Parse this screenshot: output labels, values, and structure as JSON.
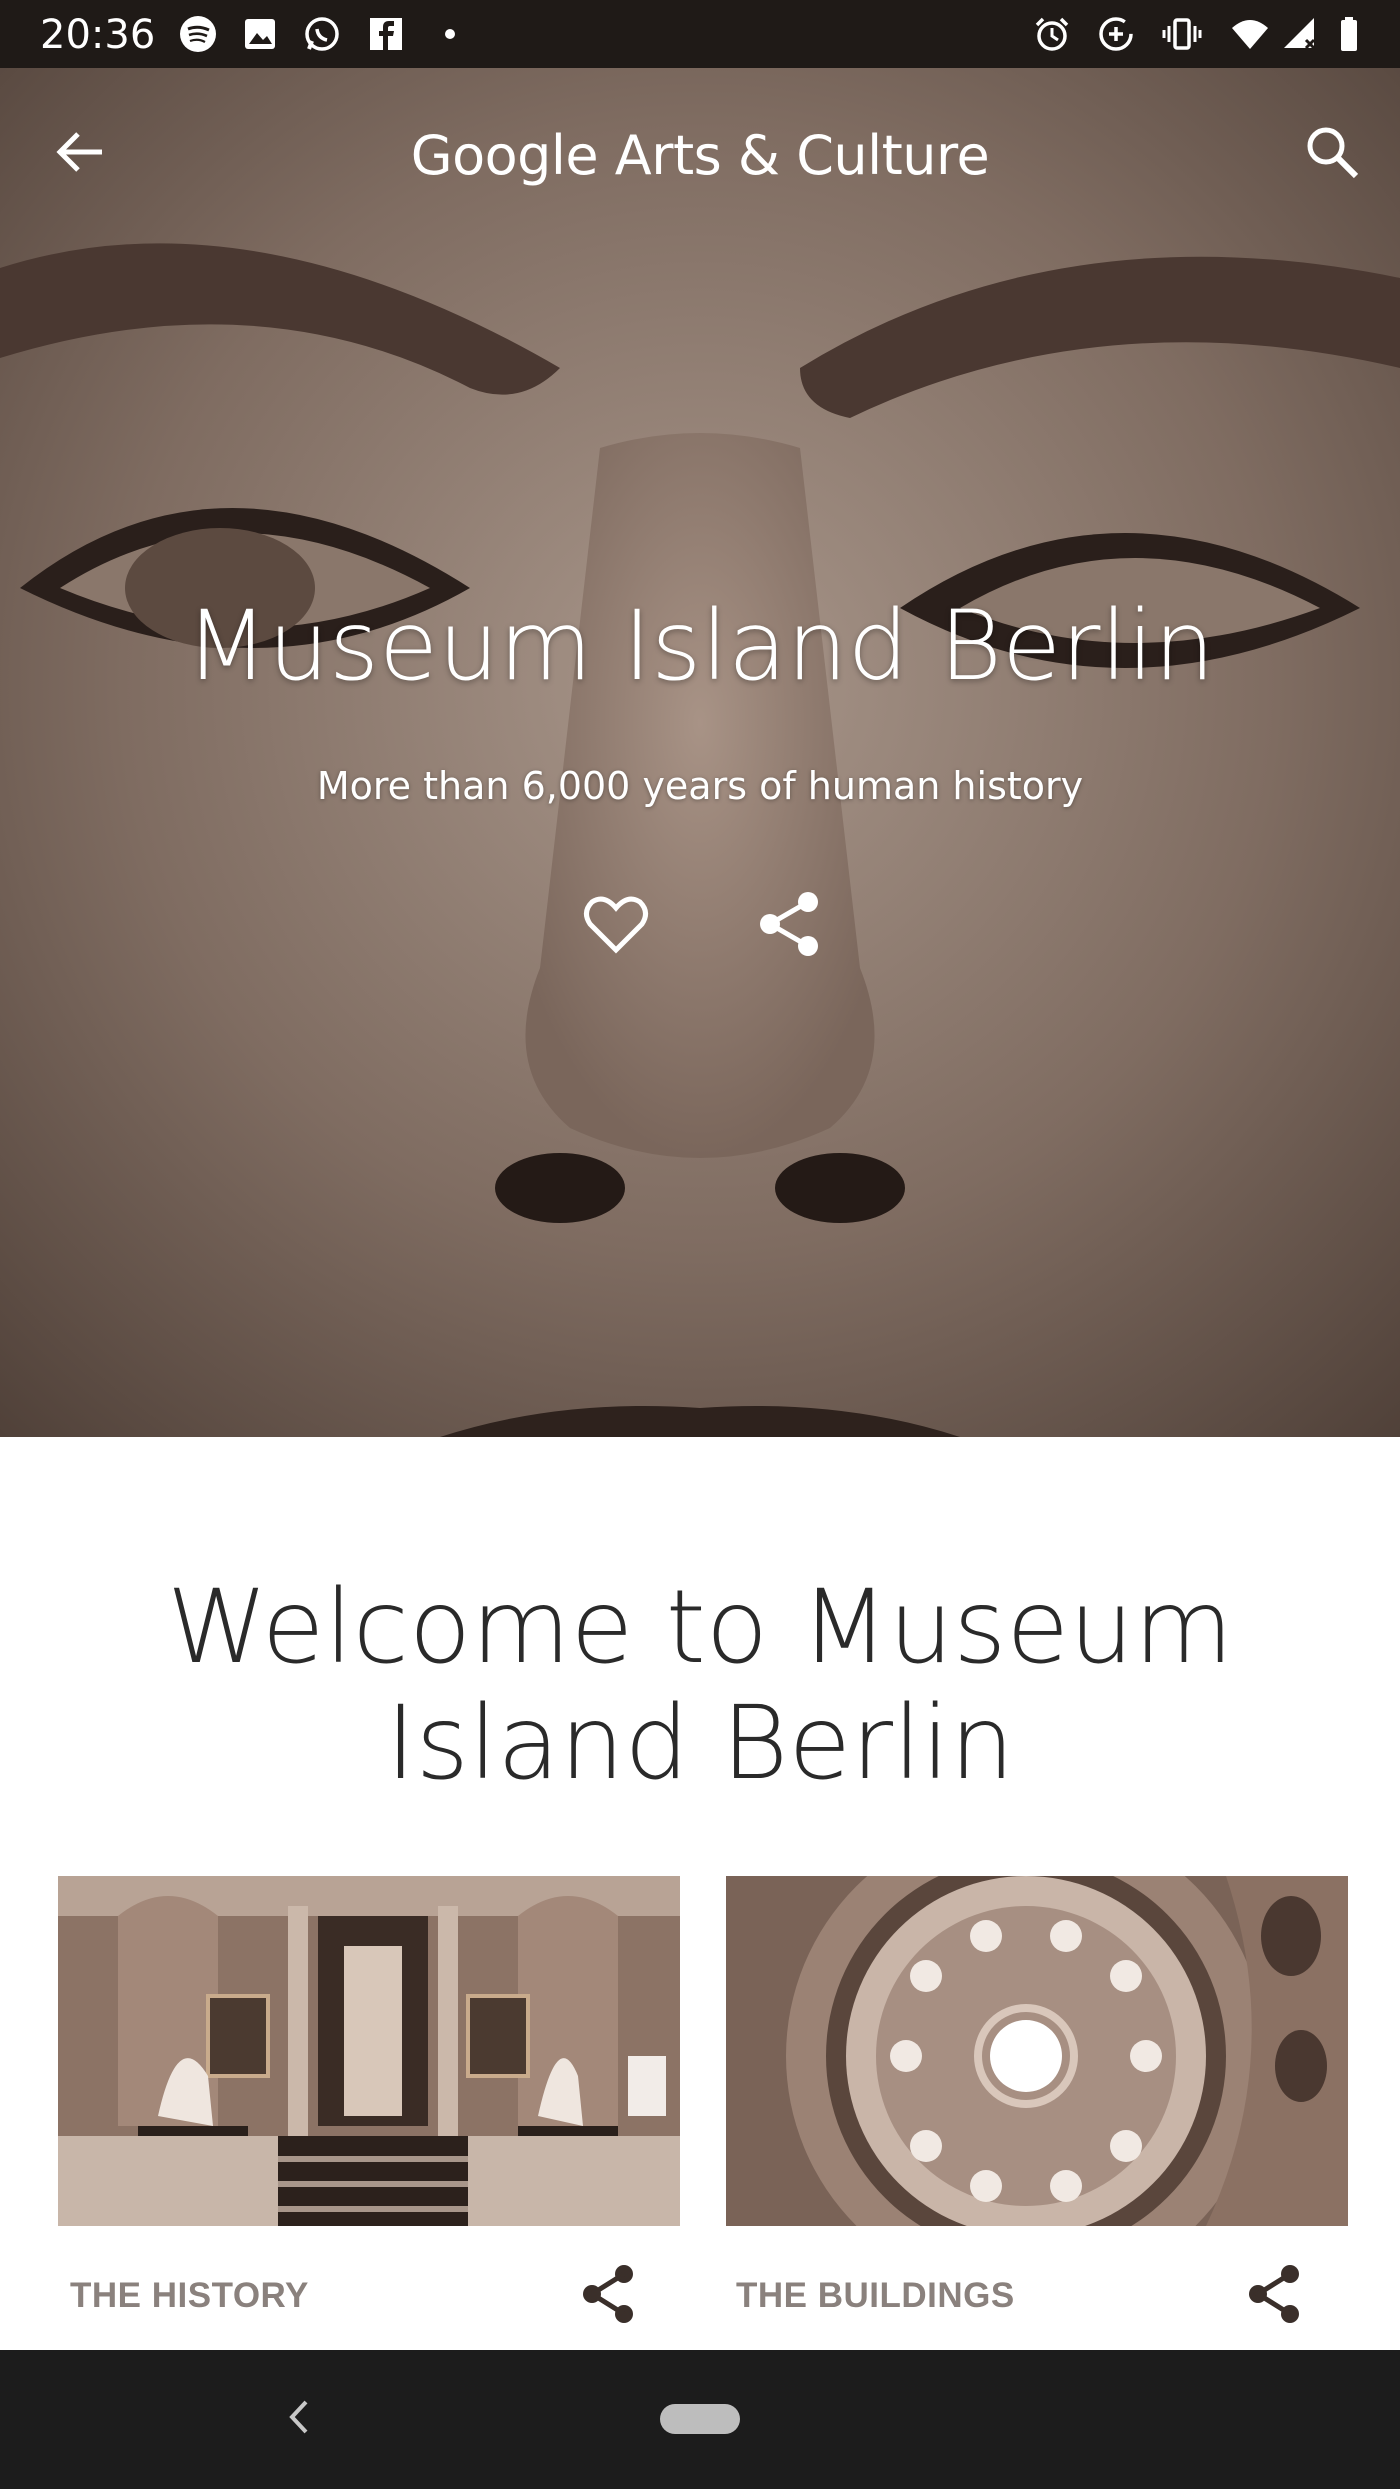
{
  "status_bar": {
    "time": "20:36",
    "left_icons": [
      "spotify-icon",
      "image-icon",
      "whatsapp-icon",
      "facebook-icon",
      "dot-icon"
    ],
    "right_icons": [
      "alarm-icon",
      "data-saver-icon",
      "vibrate-icon",
      "wifi-icon",
      "signal-icon",
      "battery-icon"
    ]
  },
  "app_bar": {
    "brand": "Google Arts & Culture",
    "back_icon": "arrow-back-icon",
    "search_icon": "search-icon"
  },
  "hero": {
    "title": "Museum Island Berlin",
    "subtitle": "More than 6,000 years of human history",
    "favorite_icon": "heart-outline-icon",
    "share_icon": "share-icon"
  },
  "welcome": {
    "heading": "Welcome to Museum Island Berlin"
  },
  "cards": [
    {
      "title": "THE HISTORY",
      "share_icon": "share-icon"
    },
    {
      "title": "THE BUILDINGS",
      "share_icon": "share-icon"
    }
  ],
  "nav_bar": {
    "back_icon": "chevron-left-icon",
    "home_icon": "home-pill-icon"
  },
  "colors": {
    "sepia_dark": "#3f2f27",
    "sepia_mid": "#7d6b60",
    "card_title": "#8a817d",
    "heading_text": "#2a2a2a"
  }
}
